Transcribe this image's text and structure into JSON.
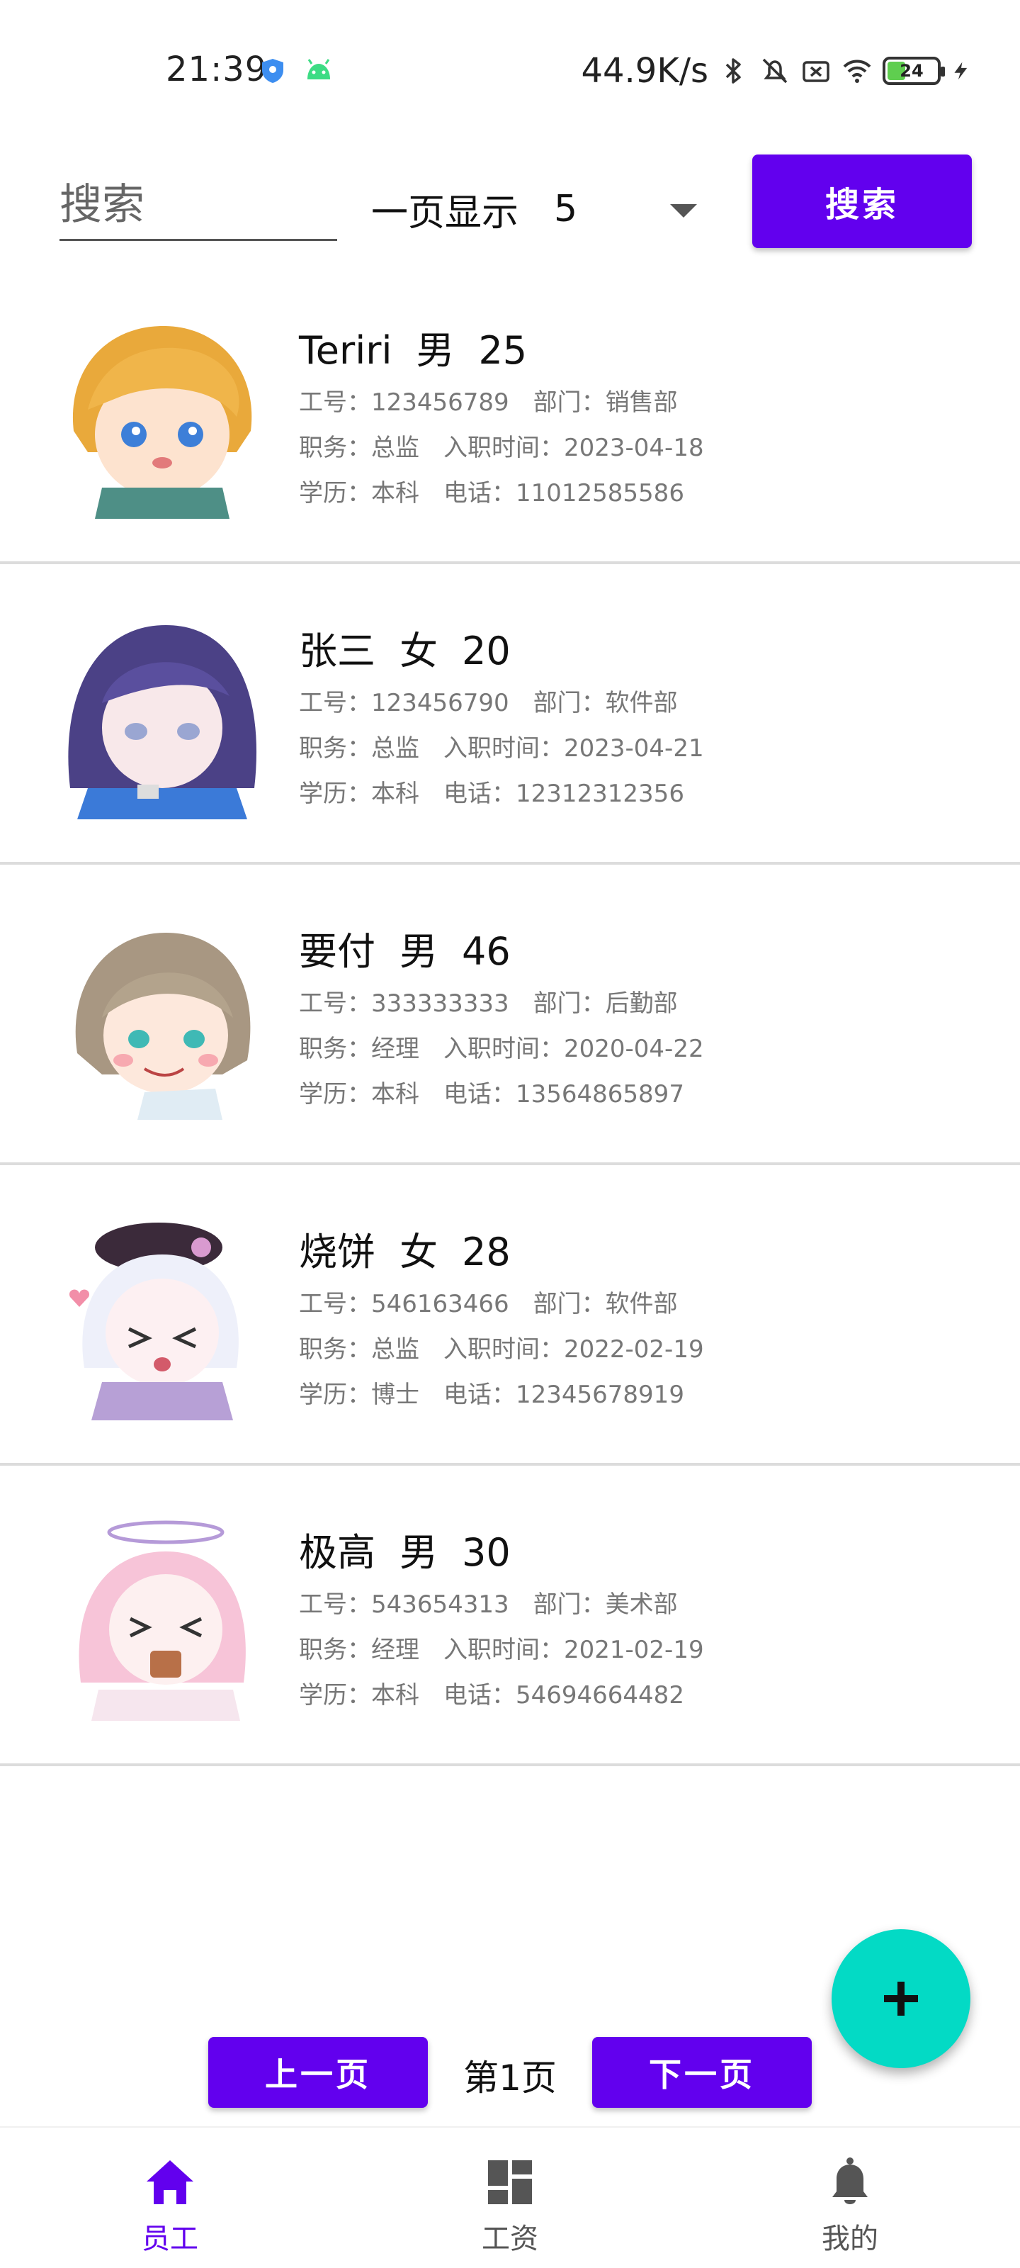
{
  "status_bar": {
    "time": "21:39",
    "net_speed": "44.9K/s",
    "battery": "24"
  },
  "search": {
    "placeholder": "搜索",
    "value": "",
    "page_size_label": "一页显示",
    "page_size_value": "5",
    "button_label": "搜索"
  },
  "employees": [
    {
      "name": "Teriri",
      "gender": "男",
      "age": "25",
      "id_text": "工号：123456789",
      "dept_text": "部门：销售部",
      "position_text": "职务：总监",
      "hire_text": "入职时间：2023-04-18",
      "edu_text": "学历：本科",
      "phone_text": "电话：11012585586"
    },
    {
      "name": "张三",
      "gender": "女",
      "age": "20",
      "id_text": "工号：123456790",
      "dept_text": "部门：软件部",
      "position_text": "职务：总监",
      "hire_text": "入职时间：2023-04-21",
      "edu_text": "学历：本科",
      "phone_text": "电话：12312312356"
    },
    {
      "name": "要付",
      "gender": "男",
      "age": "46",
      "id_text": "工号：333333333",
      "dept_text": "部门：后勤部",
      "position_text": "职务：经理",
      "hire_text": "入职时间：2020-04-22",
      "edu_text": "学历：本科",
      "phone_text": "电话：13564865897"
    },
    {
      "name": "烧饼",
      "gender": "女",
      "age": "28",
      "id_text": "工号：546163466",
      "dept_text": "部门：软件部",
      "position_text": "职务：总监",
      "hire_text": "入职时间：2022-02-19",
      "edu_text": "学历：博士",
      "phone_text": "电话：12345678919"
    },
    {
      "name": "极高",
      "gender": "男",
      "age": "30",
      "id_text": "工号：543654313",
      "dept_text": "部门：美术部",
      "position_text": "职务：经理",
      "hire_text": "入职时间：2021-02-19",
      "edu_text": "学历：本科",
      "phone_text": "电话：54694664482"
    }
  ],
  "pagination": {
    "prev_label": "上一页",
    "page_text": "第1页",
    "next_label": "下一页"
  },
  "bottom_nav": {
    "items": [
      {
        "label": "员工",
        "icon": "home-icon",
        "active": true
      },
      {
        "label": "工资",
        "icon": "dashboard-icon",
        "active": false
      },
      {
        "label": "我的",
        "icon": "bell-icon",
        "active": false
      }
    ]
  },
  "colors": {
    "primary": "#6200ee",
    "fab": "#03dac5",
    "divider": "#dcdcdc",
    "secondary_text": "#777777"
  }
}
